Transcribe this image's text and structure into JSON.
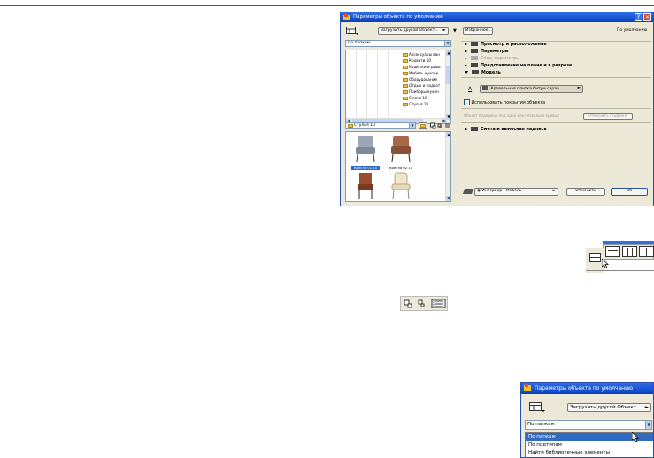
{
  "dialog": {
    "title": "Параметры объекта по умолчанию",
    "help_label": "?",
    "close_label": "✕",
    "load_other_label": "Загрузить другой Объект...",
    "favorites_label": "Избранное...",
    "default_label": "По умолчанию",
    "view_mode": "По папкам",
    "tree_items": [
      "Аксессуары ван",
      "Кровати 10",
      "Кушетки и дива",
      "Мебель кухонн",
      "Оборудование",
      "Отдых и подгот",
      "Приборы кухон",
      "Столы 10",
      "Стулья 10"
    ],
    "folder_select": "Стулья 10",
    "thumbnails": [
      {
        "caption": "Кресло 01 10",
        "selected": true
      },
      {
        "caption": "Кресло 02 10",
        "selected": false
      },
      {
        "caption": "",
        "selected": false
      },
      {
        "caption": "",
        "selected": false
      }
    ],
    "sections": {
      "view": "Просмотр и расположение",
      "params": "Параметры",
      "special": "Спец. параметры",
      "plan": "Представление на плане и в разрезе",
      "model": "Модель",
      "estimate": "Смета и выносная надпись"
    },
    "surface_label": "A",
    "material": "Кровельная плитка битум.серая",
    "use_surface": "Использовать покрытия объекта",
    "override_note": "Объект подержан под одно или несколько кривых",
    "cancel_override": "Отменить подмену",
    "layer": "Интерьер - Мебель",
    "cancel_label": "Отменить",
    "ok_label": "OK",
    "colors": {
      "titlebar": "#0a3fc0",
      "dialog_bg": "#ece9d8",
      "selection": "#316ac5"
    }
  },
  "small_dialog": {
    "title": "Параметры объекта по умолчанию",
    "load_other_label": "Загрузить другой Объект...",
    "combo_value": "По папкам",
    "options": [
      "По папкам",
      "По подтипам",
      "Найти библиотечные элементы"
    ],
    "selected_index": 0
  }
}
